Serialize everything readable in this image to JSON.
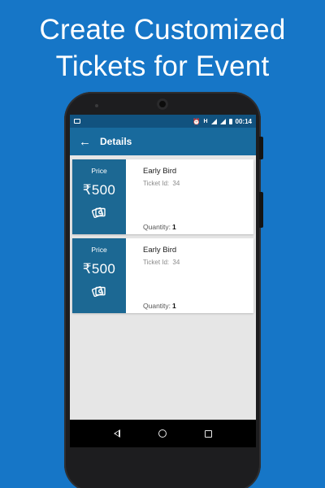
{
  "headline": {
    "line1": "Create Customized",
    "line2": "Tickets for Event"
  },
  "status_bar": {
    "time": "00:14",
    "network_label": "H",
    "icons": [
      "image-icon",
      "alarm-icon",
      "signal-icon",
      "signal-icon",
      "battery-icon"
    ]
  },
  "app_bar": {
    "back_icon": "arrow-left-icon",
    "title": "Details"
  },
  "tickets": [
    {
      "price_label": "Price",
      "price": "₹500",
      "icon": "ticket-icon",
      "name": "Early Bird",
      "id_label": "Ticket Id:",
      "id_value": "34",
      "quantity_label": "Quantity:",
      "quantity_value": "1"
    },
    {
      "price_label": "Price",
      "price": "₹500",
      "icon": "ticket-icon",
      "name": "Early Bird",
      "id_label": "Ticket Id:",
      "id_value": "34",
      "quantity_label": "Quantity:",
      "quantity_value": "1"
    }
  ],
  "nav_bar": {
    "icons": [
      "nav-back-icon",
      "nav-home-icon",
      "nav-recents-icon"
    ]
  },
  "colors": {
    "background": "#1676c7",
    "status_bar": "#11527f",
    "app_bar": "#186a9d",
    "price_panel": "#1c6893",
    "screen_background": "#e6e6e6"
  }
}
